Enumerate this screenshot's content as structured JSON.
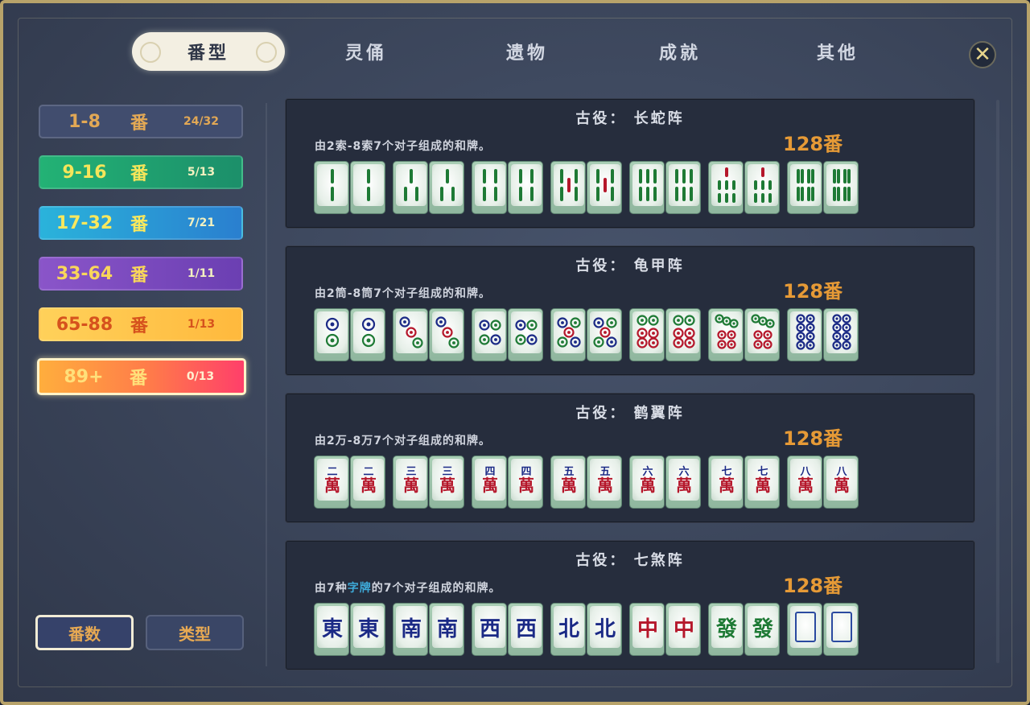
{
  "tabs": [
    {
      "label": "番型",
      "active": true
    },
    {
      "label": "灵俑",
      "active": false
    },
    {
      "label": "遗物",
      "active": false
    },
    {
      "label": "成就",
      "active": false
    },
    {
      "label": "其他",
      "active": false
    }
  ],
  "close_label": "✕",
  "categories": [
    {
      "range": "1-8",
      "fan": "番",
      "count": "24/32"
    },
    {
      "range": "9-16",
      "fan": "番",
      "count": "5/13"
    },
    {
      "range": "17-32",
      "fan": "番",
      "count": "7/21"
    },
    {
      "range": "33-64",
      "fan": "番",
      "count": "1/11"
    },
    {
      "range": "65-88",
      "fan": "番",
      "count": "1/13"
    },
    {
      "range": "89+",
      "fan": "番",
      "count": "0/13",
      "selected": true
    }
  ],
  "sort_buttons": {
    "by_fan": "番数",
    "by_type": "类型"
  },
  "cards": [
    {
      "title": "古役： 长蛇阵",
      "desc": "由2索-8索7个对子组成的和牌。",
      "score": "128番",
      "suit": "bamboo",
      "tiles": [
        2,
        2,
        3,
        3,
        4,
        4,
        5,
        5,
        6,
        6,
        7,
        7,
        8,
        8
      ]
    },
    {
      "title": "古役： 龟甲阵",
      "desc": "由2筒-8筒7个对子组成的和牌。",
      "score": "128番",
      "suit": "dots",
      "tiles": [
        2,
        2,
        3,
        3,
        4,
        4,
        5,
        5,
        6,
        6,
        7,
        7,
        8,
        8
      ]
    },
    {
      "title": "古役： 鹤翼阵",
      "desc": "由2万-8万7个对子组成的和牌。",
      "score": "128番",
      "suit": "characters",
      "tiles": [
        "二",
        "二",
        "三",
        "三",
        "四",
        "四",
        "五",
        "五",
        "六",
        "六",
        "七",
        "七",
        "八",
        "八"
      ],
      "wan_char": "萬"
    },
    {
      "title": "古役： 七煞阵",
      "desc_prefix": "由7种",
      "desc_highlight": "字牌",
      "desc_suffix": "的7个对子组成的和牌。",
      "score": "128番",
      "suit": "honors",
      "tiles": [
        "東",
        "東",
        "南",
        "南",
        "西",
        "西",
        "北",
        "北",
        "中",
        "中",
        "發",
        "發",
        "",
        ""
      ]
    }
  ],
  "colors": {
    "score": "#e69a36",
    "highlight": "#3eaad9",
    "tile_green": "#1e7a35",
    "tile_red": "#b5172b",
    "tile_blue": "#1b2a86"
  }
}
